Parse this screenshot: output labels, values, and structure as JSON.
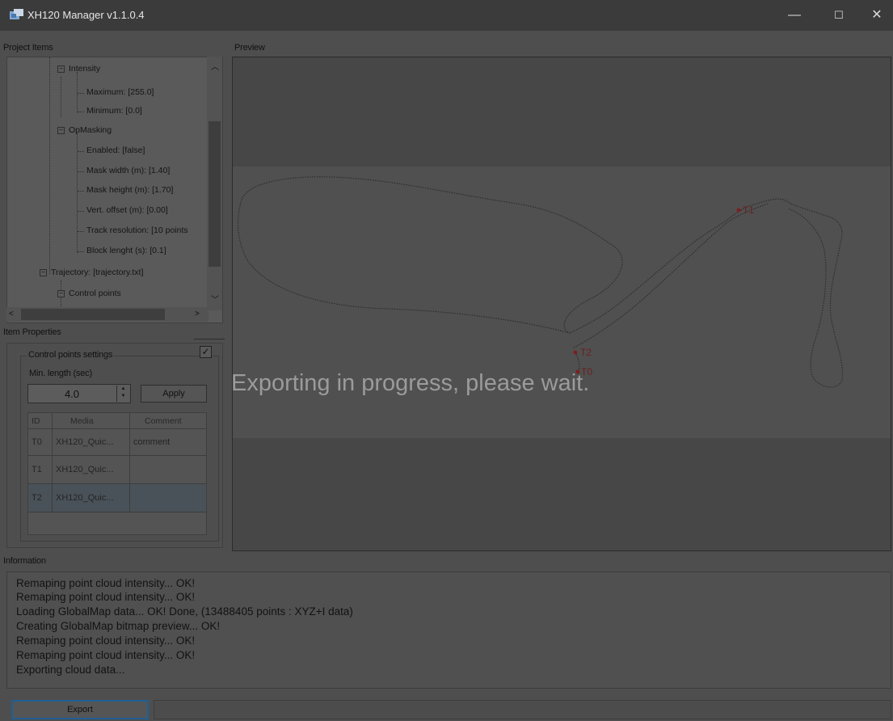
{
  "window": {
    "title": "XH120 Manager v1.1.0.4",
    "minimize": "—",
    "maximize": "☐",
    "close": "✕"
  },
  "project_items": {
    "label": "Project Items",
    "nodes": [
      {
        "text": "Intensity"
      },
      {
        "text": "Maximum: [255.0]"
      },
      {
        "text": "Minimum: [0.0]"
      },
      {
        "text": "OpMasking"
      },
      {
        "text": "Enabled: [false]"
      },
      {
        "text": "Mask width (m): [1.40]"
      },
      {
        "text": "Mask height (m): [1.70]"
      },
      {
        "text": "Vert. offset (m): [0.00]"
      },
      {
        "text": "Track resolution: [10 points"
      },
      {
        "text": "Block lenght (s): [0.1]"
      },
      {
        "text": "Trajectory: [trajectory.txt]"
      },
      {
        "text": "Control points"
      }
    ]
  },
  "item_properties": {
    "label": "Item Properties",
    "group_label": "Control points settings",
    "checkbox_checked": true,
    "min_length_label": "Min. length (sec)",
    "min_length_value": "4.0",
    "apply_label": "Apply",
    "grid": {
      "columns": [
        "ID",
        "Media",
        "Comment"
      ],
      "rows": [
        {
          "id": "T0",
          "media": "XH120_Quic...",
          "comment": "comment"
        },
        {
          "id": "T1",
          "media": "XH120_Quic...",
          "comment": ""
        },
        {
          "id": "T2",
          "media": "XH120_Quic...",
          "comment": ""
        }
      ],
      "selected_row": "T2"
    }
  },
  "preview": {
    "label": "Preview",
    "overlay_message": "Exporting in progress, please wait.",
    "control_point_labels": {
      "t0": "T0",
      "t1": "T1",
      "t2": "T2"
    }
  },
  "information": {
    "label": "Information",
    "log": [
      "Remaping point cloud intensity... OK!",
      "Remaping point cloud intensity... OK!",
      "Loading GlobalMap data... OK! Done, (13488405 points : XYZ+I data)",
      "Creating GlobalMap bitmap preview... OK!",
      "Remaping point cloud intensity... OK!",
      "Remaping point cloud intensity... OK!",
      "Exporting cloud data..."
    ]
  },
  "footer": {
    "export_label": "Export",
    "status_text": ""
  },
  "colors": {
    "accent": "#1f5f95",
    "trajectory": "#2a2a2a",
    "control_point": "#7a2020"
  }
}
